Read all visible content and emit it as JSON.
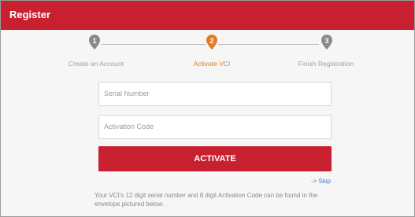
{
  "header": {
    "title": "Register"
  },
  "colors": {
    "brand_red": "#c8202f",
    "active_step": "#e37c22",
    "inactive_step": "#8a8a8a",
    "link": "#4a7ab8"
  },
  "steps": [
    {
      "number": "1",
      "label": "Create an Account",
      "state": "done"
    },
    {
      "number": "2",
      "label": "Activate VCI",
      "state": "active"
    },
    {
      "number": "3",
      "label": "Finish Registration",
      "state": "pending"
    }
  ],
  "form": {
    "serial_placeholder": "Serial Number",
    "activation_placeholder": "Activation Code",
    "activate_label": "ACTIVATE",
    "skip_label": "-> Skip"
  },
  "info_text": "Your VCI's 12 digit serial number and 8 digit Activation Code can be found in the envelope pictured below."
}
